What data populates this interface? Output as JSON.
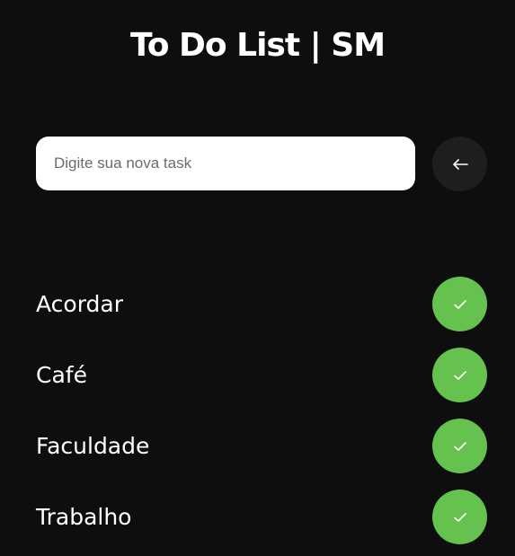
{
  "header": {
    "title": "To Do List | SM"
  },
  "new_task": {
    "placeholder": "Digite sua nova task",
    "value": "",
    "submit_icon": "arrow-left-icon"
  },
  "tasks": [
    {
      "label": "Acordar",
      "action_icon": "check-icon"
    },
    {
      "label": "Café",
      "action_icon": "check-icon"
    },
    {
      "label": "Faculdade",
      "action_icon": "check-icon"
    },
    {
      "label": "Trabalho",
      "action_icon": "check-icon"
    }
  ],
  "colors": {
    "background": "#0e0e0e",
    "accent_done": "#66c24e",
    "submit_button": "#1e1e1e",
    "input_background": "#ffffff"
  }
}
